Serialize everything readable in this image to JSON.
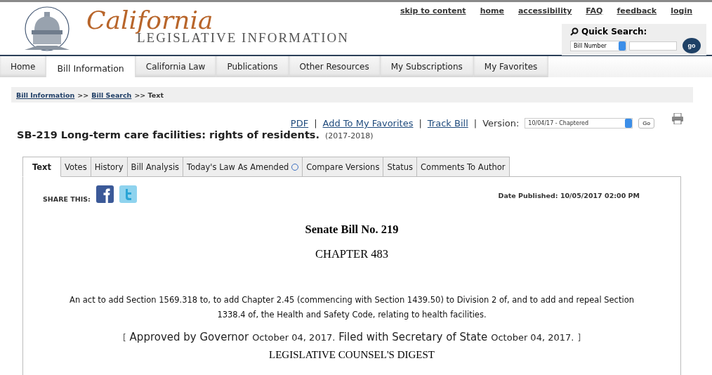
{
  "header": {
    "logo_script": "California",
    "logo_subtitle": "LEGISLATIVE INFORMATION",
    "top_links": [
      "skip to content",
      "home",
      "accessibility",
      "FAQ",
      "feedback",
      "login"
    ],
    "quick_search": {
      "label": "Quick Search:",
      "select_value": "Bill Number",
      "button": "go"
    }
  },
  "nav_tabs": [
    {
      "label": "Home",
      "selected": false
    },
    {
      "label": "Bill Information",
      "selected": true
    },
    {
      "label": "California Law",
      "selected": false
    },
    {
      "label": "Publications",
      "selected": false
    },
    {
      "label": "Other Resources",
      "selected": false
    },
    {
      "label": "My Subscriptions",
      "selected": false
    },
    {
      "label": "My Favorites",
      "selected": false
    }
  ],
  "breadcrumb": [
    {
      "label": "Bill Information",
      "kind": "link"
    },
    {
      "label": ">>",
      "kind": "text"
    },
    {
      "label": "Bill Search",
      "kind": "link"
    },
    {
      "label": ">> Text",
      "kind": "text"
    }
  ],
  "actions": {
    "links": [
      "PDF",
      "Add To My Favorites",
      "Track Bill"
    ],
    "separators": [
      "|",
      "|",
      "|"
    ],
    "version_label": "Version:",
    "version_value": "10/04/17 - Chaptered",
    "go_button": "Go"
  },
  "bill": {
    "title": "SB-219 Long-term care facilities: rights of residents.",
    "session": "(2017-2018)"
  },
  "bill_tabs": [
    {
      "label": "Text",
      "selected": true,
      "info": false
    },
    {
      "label": "Votes",
      "selected": false,
      "info": false
    },
    {
      "label": "History",
      "selected": false,
      "info": false
    },
    {
      "label": "Bill Analysis",
      "selected": false,
      "info": false
    },
    {
      "label": "Today's Law As Amended",
      "selected": false,
      "info": true
    },
    {
      "label": "Compare Versions",
      "selected": false,
      "info": false
    },
    {
      "label": "Status",
      "selected": false,
      "info": false
    },
    {
      "label": "Comments To Author",
      "selected": false,
      "info": false
    }
  ],
  "content": {
    "share_label": "SHARE THIS:",
    "date_published": "Date Published: 10/05/2017 02:00 PM",
    "heading": "Senate Bill No. 219",
    "chapter": "CHAPTER 483",
    "act_text": "An act to add Section 1569.318 to, to add Chapter 2.45 (commencing with Section 1439.50) to Division 2 of, and to add and repeal Section 1338.4 of, the Health and Safety Code, relating to health facilities.",
    "approved": {
      "open": "[",
      "governor": "Approved by Governor",
      "governor_date": "October 04, 2017.",
      "secretary": "Filed with Secretary of State",
      "secretary_date": "October 04, 2017.",
      "close": "]"
    },
    "digest_heading": "LEGISLATIVE COUNSEL'S DIGEST"
  }
}
